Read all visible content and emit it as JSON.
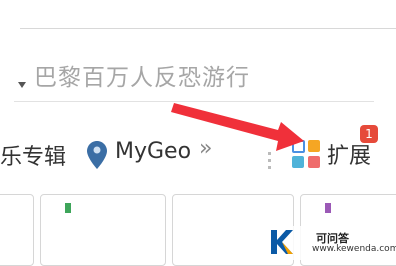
{
  "search": {
    "text": "巴黎百万人反恐游行"
  },
  "bookmarks": {
    "partial_label": "乐专辑",
    "mygeo_label": "MyGeo",
    "more_label": "»"
  },
  "extensions": {
    "label": "扩展",
    "badge_count": "1"
  },
  "watermark": {
    "site_name_cn": "可问答",
    "site_url": "www.kewenda.com"
  },
  "colors": {
    "arrow": "#f0303a",
    "badge": "#e64a3a",
    "pin": "#3b6ea5"
  }
}
